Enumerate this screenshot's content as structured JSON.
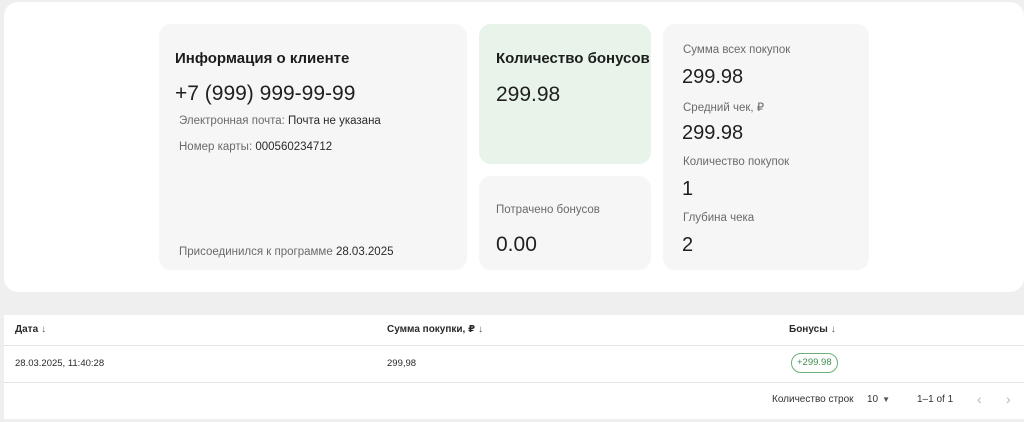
{
  "client_card": {
    "title": "Информация о клиенте",
    "phone": "+7 (999) 999-99-99",
    "email_label": "Электронная почта:",
    "email_value": "Почта не указана",
    "card_label": "Номер карты:",
    "card_value": "000560234712",
    "joined_label": "Присоединился к программе",
    "joined_value": "28.03.2025"
  },
  "bonus_card": {
    "title": "Количество бонусов",
    "value": "299.98"
  },
  "spent_card": {
    "label": "Потрачено бонусов",
    "value": "0.00"
  },
  "stats_card": {
    "total_label": "Сумма всех покупок",
    "total_value": "299.98",
    "avg_label": "Средний чек, ₽",
    "avg_value": "299.98",
    "count_label": "Количество покупок",
    "count_value": "1",
    "depth_label": "Глубина чека",
    "depth_value": "2"
  },
  "table": {
    "columns": [
      "Дата",
      "Сумма покупки, ₽",
      "Бонусы"
    ],
    "sort_arrow": "↓",
    "rows": [
      {
        "date": "28.03.2025, 11:40:28",
        "amount": "299,98",
        "bonus": "+299.98"
      }
    ],
    "footer": {
      "rows_per_page_label": "Количество строк",
      "rows_per_page_value": "10",
      "range": "1–1 of 1",
      "prev_icon": "‹",
      "next_icon": "›"
    }
  },
  "colors": {
    "bonus_card_bg": "#e8f4ea",
    "chip_border": "#6ab07a",
    "chip_text": "#3f8c50"
  }
}
